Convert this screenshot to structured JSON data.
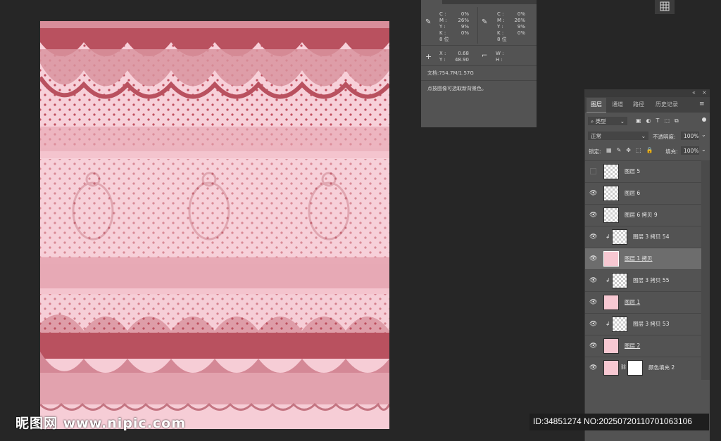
{
  "canvas": {
    "bg_color": "#f6cdd6",
    "dot_color": "#c0505f",
    "lace_dark": "#b9515f"
  },
  "info_panel": {
    "cmyk_left": {
      "labels": [
        "C :",
        "M :",
        "Y :",
        "K :"
      ],
      "values": [
        "0%",
        "26%",
        "9%",
        "0%"
      ],
      "bits": "8 位"
    },
    "cmyk_right": {
      "labels": [
        "C :",
        "M :",
        "Y :",
        "K :"
      ],
      "values": [
        "0%",
        "26%",
        "9%",
        "0%"
      ],
      "bits": "8 位"
    },
    "xy": {
      "x_label": "X :",
      "x_value": "0.68",
      "y_label": "Y :",
      "y_value": "48.90"
    },
    "wh": {
      "w_label": "W :",
      "h_label": "H :"
    },
    "doc": "文档:754.7M/1.57G",
    "hint": "点按图像可选取新背景色。"
  },
  "layers_panel": {
    "tabs": [
      "图层",
      "通道",
      "路径",
      "历史记录"
    ],
    "filter_type": "类型",
    "blend_mode": "正常",
    "opacity_label": "不透明度:",
    "opacity_value": "100%",
    "lock_label": "锁定:",
    "fill_label": "填充:",
    "fill_value": "100%",
    "layers": [
      {
        "name": "图层 5",
        "visible": false
      },
      {
        "name": "图层 6",
        "visible": true
      },
      {
        "name": "图层 6 拷贝 9",
        "visible": true
      },
      {
        "name": "图层 3 拷贝 54",
        "visible": true
      },
      {
        "name": "图层 1 拷贝",
        "visible": true,
        "selected": true
      },
      {
        "name": "图层 3 拷贝 55",
        "visible": true
      },
      {
        "name": "图层 1",
        "visible": true
      },
      {
        "name": "图层 3 拷贝 53",
        "visible": true
      },
      {
        "name": "图层 2",
        "visible": true
      },
      {
        "name": "颜色填充 2",
        "visible": true
      }
    ]
  },
  "watermark": {
    "site": "昵图网 www.nipic.com",
    "id_text": "ID:34851274 NO:20250720110701063106"
  }
}
